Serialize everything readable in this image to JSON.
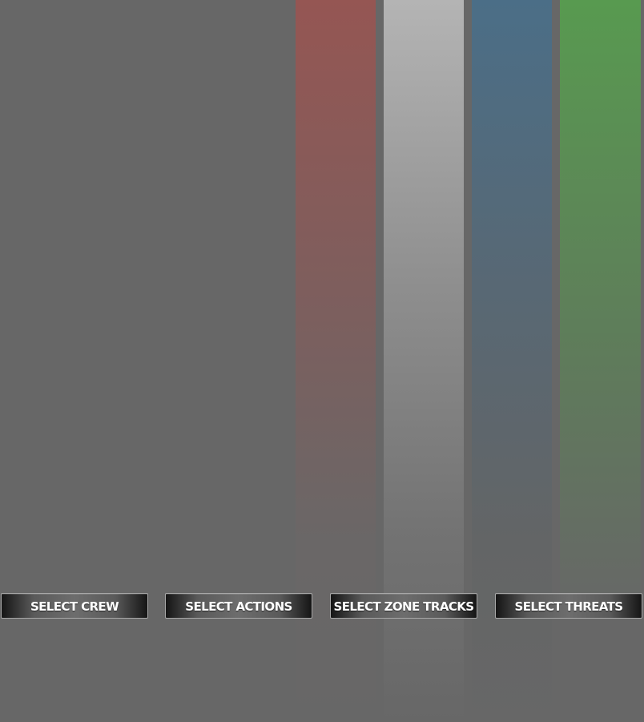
{
  "stripes": {
    "colors": [
      "#955653",
      "#b4b4b4",
      "#4b6e87",
      "#589a50"
    ]
  },
  "buttons": {
    "crew": "SELECT CREW",
    "actions": "SELECT ACTIONS",
    "zone_tracks": "SELECT ZONE TRACKS",
    "threats": "SELECT THREATS"
  }
}
